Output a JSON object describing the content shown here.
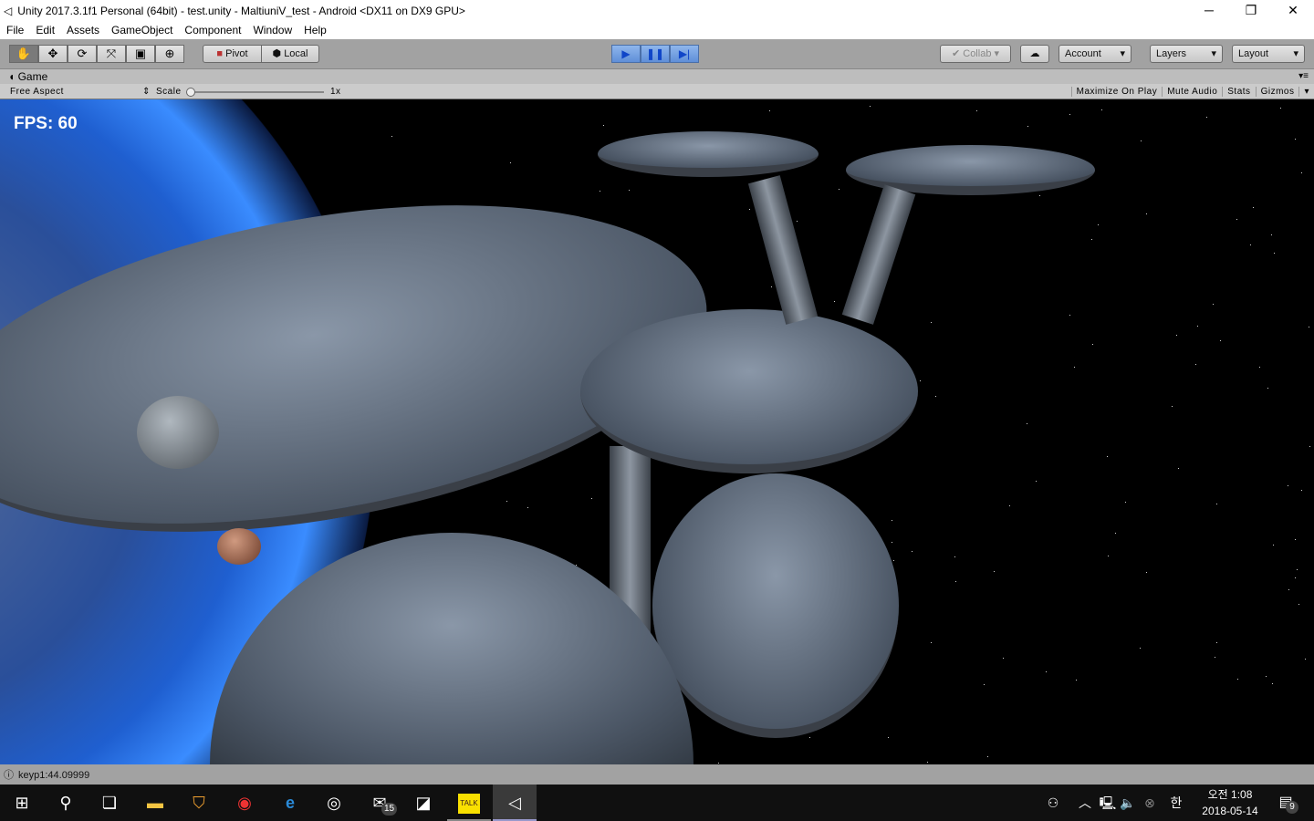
{
  "window": {
    "title": "Unity 2017.3.1f1 Personal (64bit) - test.unity - MaltiuniV_test - Android <DX11 on DX9 GPU>",
    "minimize": "─",
    "restore": "❐",
    "close": "✕"
  },
  "menu": [
    "File",
    "Edit",
    "Assets",
    "GameObject",
    "Component",
    "Window",
    "Help"
  ],
  "toolbar": {
    "tools": [
      "✋",
      "✥",
      "⟳",
      "⤧",
      "▣",
      "⊕"
    ],
    "pivot": "Pivot",
    "local": "Local",
    "play": "▶",
    "pause": "❚❚",
    "step": "▶|",
    "collab": "Collab ▾",
    "cloud": "☁",
    "account": "Account",
    "layers": "Layers",
    "layout": "Layout",
    "dropdown": "▾"
  },
  "game": {
    "tab": "Game",
    "aspect": "Free Aspect",
    "scale_label": "Scale",
    "scale_value": "1x",
    "scale_fraction": 0,
    "buttons": [
      "Maximize On Play",
      "Mute Audio",
      "Stats",
      "Gizmos"
    ],
    "fps": "FPS: 60"
  },
  "status": {
    "message": "keyp1:44.09999"
  },
  "taskbar": {
    "mail_badge": "15",
    "ime": "한",
    "time": "오전 1:08",
    "date": "2018-05-14",
    "notif_badge": "9",
    "talk": "TALK"
  }
}
